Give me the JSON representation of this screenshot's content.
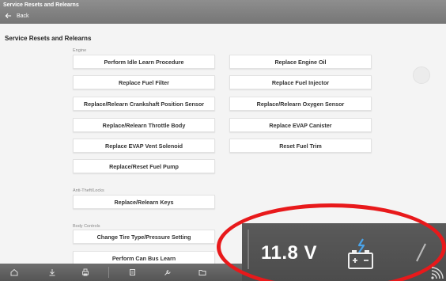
{
  "window": {
    "title": "Service Resets and Relearns"
  },
  "nav": {
    "back_label": "Back"
  },
  "page": {
    "title": "Service Resets and Relearns"
  },
  "sections": {
    "engine": {
      "label": "Engine",
      "buttons": [
        "Perform Idle Learn Procedure",
        "Replace Engine Oil",
        "Replace Fuel Filter",
        "Replace Fuel Injector",
        "Replace/Relearn Crankshaft Position Sensor",
        "Replace/Relearn Oxygen Sensor",
        "Replace/Relearn Throttle Body",
        "Replace EVAP Canister",
        "Replace EVAP Vent Solenoid",
        "Reset Fuel Trim",
        "Replace/Reset Fuel Pump"
      ]
    },
    "anti_theft": {
      "label": "Anti-Theft/Locks",
      "buttons": [
        "Replace/Relearn Keys"
      ]
    },
    "body_controls": {
      "label": "Body Controls",
      "buttons": [
        "Change Tire Type/Pressure Setting",
        "Perform Can Bus Learn"
      ]
    }
  },
  "status": {
    "voltage": "11.8 V"
  },
  "icons": {
    "toolbar": [
      "home-icon",
      "download-icon",
      "print-icon",
      "snapshot-icon",
      "tools-icon",
      "folder-icon"
    ],
    "battery": "battery-icon",
    "wireless": "wireless-icon"
  },
  "colors": {
    "annotation_ring": "#e8191b",
    "topbar": "#808080"
  }
}
